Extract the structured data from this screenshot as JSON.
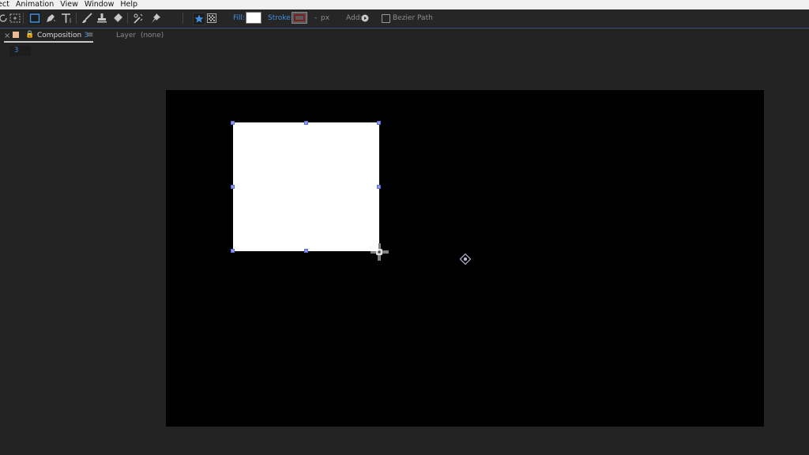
{
  "menu": {
    "items": [
      "ect",
      "Animation",
      "View",
      "Window",
      "Help"
    ]
  },
  "toolbar": {
    "tools": [
      "rotate-tool",
      "pan-behind-tool",
      "rectangle-tool",
      "pen-tool",
      "type-tool",
      "brush-tool",
      "clone-stamp-tool",
      "eraser-tool",
      "roto-brush-tool",
      "puppet-pin-tool"
    ],
    "fill_label": "Fill:",
    "fill_color": "#ffffff",
    "stroke_label": "Stroke:",
    "stroke_width": "-",
    "stroke_unit": "px",
    "add_label": "Add:",
    "bezier_label": "Bezier Path"
  },
  "panel": {
    "tab_title": "Composition",
    "tab_number": "3",
    "layer_label": "Layer",
    "layer_value": "(none)",
    "breadcrumb": "3"
  },
  "colors": {
    "accent": "#3f8fe0",
    "canvas": "#000000",
    "shape_fill": "#ffffff",
    "handle": "#8b9bf0",
    "tab_color": "#e8b995"
  }
}
